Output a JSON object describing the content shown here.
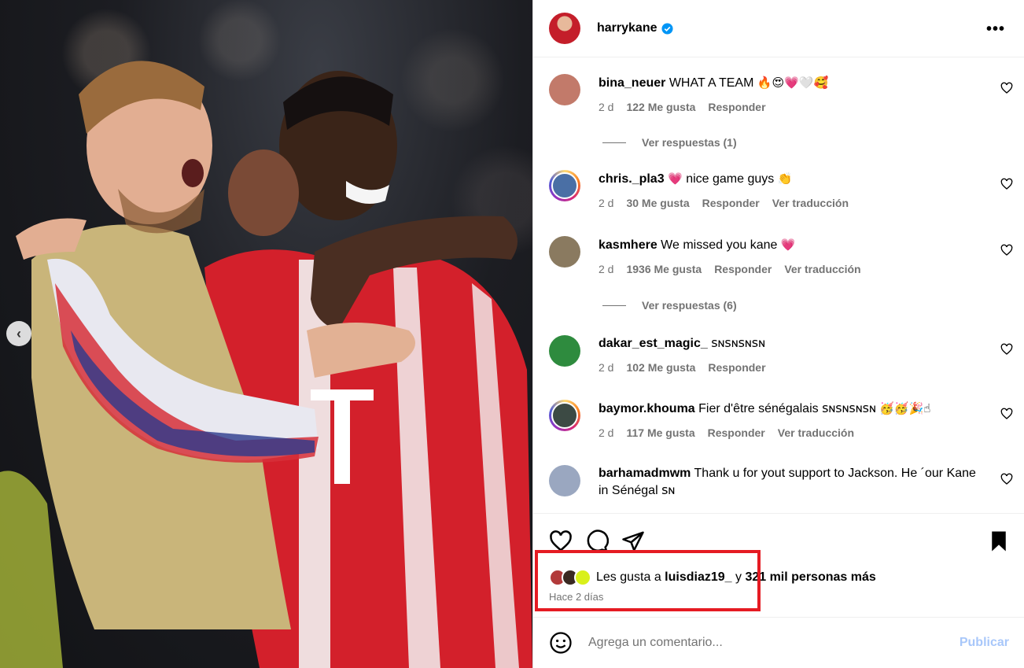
{
  "post": {
    "username": "harrykane",
    "verified": true,
    "more_label": "•••"
  },
  "photo": {
    "prev_label": "‹"
  },
  "comments": [
    {
      "username": "bina_neuer",
      "text": "WHAT A TEAM",
      "emojis": "🔥😍💗🤍🥰",
      "time": "2 d",
      "likes": "122 Me gusta",
      "reply": "Responder",
      "translate": "",
      "ring": false,
      "avatar_color": "#c27a6a"
    },
    {
      "username": "chris._pla3",
      "text": "nice game guys",
      "prefix_emoji": "💗",
      "emojis": "👏",
      "time": "2 d",
      "likes": "30 Me gusta",
      "reply": "Responder",
      "translate": "Ver traducción",
      "ring": true,
      "avatar_color": "#4a6fa5"
    },
    {
      "username": "kasmhere",
      "text": "We missed you kane",
      "emojis": "💗",
      "time": "2 d",
      "likes": "1936 Me gusta",
      "reply": "Responder",
      "translate": "Ver traducción",
      "ring": false,
      "avatar_color": "#8a7a60"
    },
    {
      "username": "dakar_est_magic_",
      "text": "ꜱɴꜱɴꜱɴꜱɴ",
      "emojis": "",
      "time": "2 d",
      "likes": "102 Me gusta",
      "reply": "Responder",
      "translate": "",
      "ring": false,
      "avatar_color": "#2e8b3e"
    },
    {
      "username": "baymor.khouma",
      "text": "Fier d'être sénégalais ꜱɴꜱɴꜱɴꜱɴ",
      "emojis": "🥳🥳🎉☝",
      "time": "2 d",
      "likes": "117 Me gusta",
      "reply": "Responder",
      "translate": "Ver traducción",
      "ring": true,
      "avatar_color": "#3c4a44"
    },
    {
      "username": "barhamadmwm",
      "text": "Thank u for yout support to Jackson. He ´our Kane in Sénégal ꜱɴ",
      "emojis": "",
      "time": "",
      "likes": "",
      "reply": "",
      "translate": "",
      "ring": false,
      "avatar_color": "#9aa7c0"
    }
  ],
  "replies": [
    {
      "label": "Ver respuestas (1)"
    },
    {
      "label": "Ver respuestas (6)"
    }
  ],
  "likes": {
    "prefix": "Les gusta a ",
    "user": "luisdiaz19_",
    "middle": " y ",
    "count": "321 mil personas más"
  },
  "time_ago": "Hace 2 días",
  "add_comment": {
    "placeholder": "Agrega un comentario...",
    "publish": "Publicar"
  },
  "colors": {
    "highlight": "#e51b23",
    "verified": "#0095f6",
    "publish": "#a8c7fa"
  }
}
